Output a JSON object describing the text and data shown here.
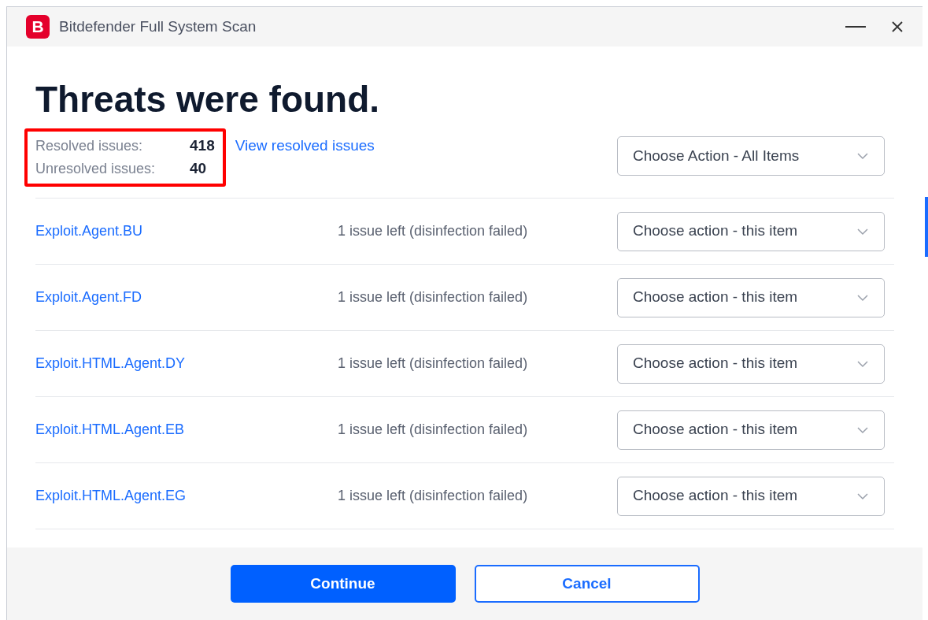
{
  "window": {
    "title": "Bitdefender Full System Scan",
    "logo_letter": "B"
  },
  "heading": "Threats were found.",
  "summary": [
    {
      "label": "Resolved issues:",
      "value": "418"
    },
    {
      "label": "Unresolved issues:",
      "value": "40"
    }
  ],
  "view_link": "View resolved issues",
  "bulk_action": {
    "placeholder": "Choose Action - All Items"
  },
  "threats": [
    {
      "name": "Exploit.Agent.BU",
      "status": "1 issue left (disinfection failed)",
      "action": "Choose action - this item"
    },
    {
      "name": "Exploit.Agent.FD",
      "status": "1 issue left (disinfection failed)",
      "action": "Choose action - this item"
    },
    {
      "name": "Exploit.HTML.Agent.DY",
      "status": "1 issue left (disinfection failed)",
      "action": "Choose action - this item"
    },
    {
      "name": "Exploit.HTML.Agent.EB",
      "status": "1 issue left (disinfection failed)",
      "action": "Choose action - this item"
    },
    {
      "name": "Exploit.HTML.Agent.EG",
      "status": "1 issue left (disinfection failed)",
      "action": "Choose action - this item"
    }
  ],
  "buttons": [
    {
      "label": "Continue",
      "kind": "primary"
    },
    {
      "label": "Cancel",
      "kind": "secondary"
    }
  ]
}
